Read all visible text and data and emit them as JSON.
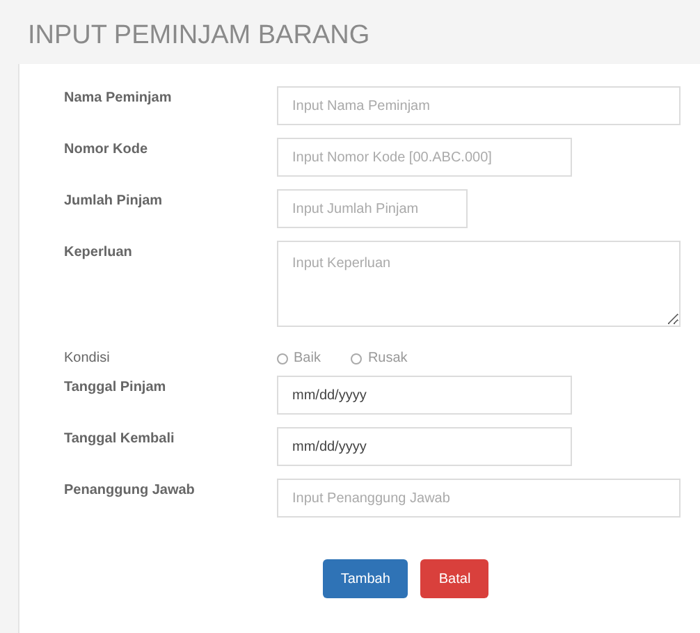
{
  "title": "INPUT PEMINJAM BARANG",
  "fields": [
    {
      "kind": "text",
      "label": "Nama Peminjam",
      "placeholder": "Input Nama Peminjam"
    },
    {
      "kind": "text",
      "label": "Nomor Kode",
      "placeholder": "Input Nomor Kode [00.ABC.000]"
    },
    {
      "kind": "text",
      "label": "Jumlah Pinjam",
      "placeholder": "Input Jumlah Pinjam"
    },
    {
      "kind": "textarea",
      "label": "Keperluan",
      "placeholder": "Input Keperluan"
    },
    {
      "kind": "radio",
      "label": "Kondisi",
      "options": [
        {
          "label": "Baik",
          "selected": false
        },
        {
          "label": "Rusak",
          "selected": false
        }
      ]
    },
    {
      "kind": "date",
      "label": "Tanggal Pinjam",
      "value": "mm/dd/yyyy"
    },
    {
      "kind": "date",
      "label": "Tanggal Kembali",
      "value": "mm/dd/yyyy"
    },
    {
      "kind": "text",
      "label": "Penanggung Jawab",
      "placeholder": "Input Penanggung Jawab"
    }
  ],
  "buttons": [
    {
      "kind": "primary",
      "label": "Tambah"
    },
    {
      "kind": "danger",
      "label": "Batal"
    }
  ]
}
